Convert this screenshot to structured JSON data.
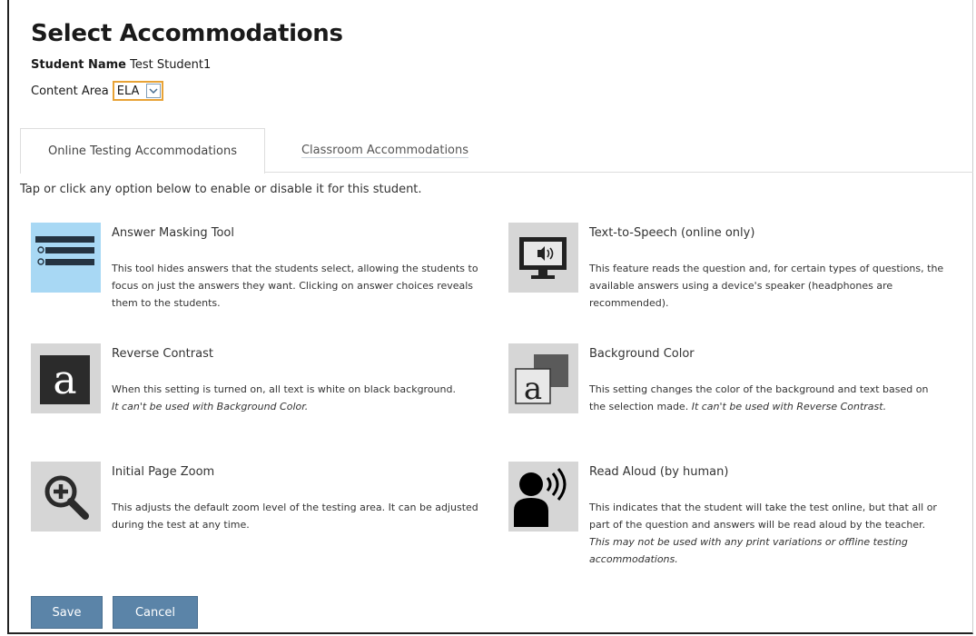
{
  "page": {
    "title": "Select Accommodations",
    "student_label": "Student Name",
    "student_name": "Test Student1",
    "content_area_label": "Content Area",
    "content_area_value": "ELA"
  },
  "tabs": [
    {
      "label": "Online Testing Accommodations",
      "active": true
    },
    {
      "label": "Classroom Accommodations",
      "active": false
    }
  ],
  "instructions": "Tap or click any option below to enable or disable it for this student.",
  "accommodations": [
    {
      "name": "Answer Masking Tool",
      "description": "This tool hides answers that the students select, allowing the students to focus on just the answers they want. Clicking on answer choices reveals them to the students.",
      "note": "",
      "icon": "answer-masking-icon",
      "enabled": true
    },
    {
      "name": "Text-to-Speech (online only)",
      "description": "This feature reads the question and, for certain types of questions, the available answers using a device's speaker (headphones are recommended).",
      "note": "",
      "icon": "monitor-speaker-icon",
      "enabled": false
    },
    {
      "name": "Reverse Contrast",
      "description": "When this setting is turned on, all text is white on black background.",
      "note": "It can't be used with Background Color.",
      "icon": "reverse-contrast-icon",
      "enabled": false
    },
    {
      "name": "Background Color",
      "description": "This setting changes the color of the background and text based on the selection made.",
      "note": "It can't be used with Reverse Contrast.",
      "icon": "background-color-icon",
      "enabled": false
    },
    {
      "name": "Initial Page Zoom",
      "description": "This adjusts the default zoom level of the testing area. It can be adjusted during the test at any time.",
      "note": "",
      "icon": "zoom-in-icon",
      "enabled": false
    },
    {
      "name": "Read Aloud (by human)",
      "description": "This indicates that the student will take the test online, but that all or part of the question and answers will be read aloud by the teacher.",
      "note": "This may not be used with any print variations or offline testing accommodations.",
      "icon": "person-speaking-icon",
      "enabled": false
    }
  ],
  "buttons": {
    "save": "Save",
    "cancel": "Cancel"
  },
  "colors": {
    "enabled_icon_bg": "#a8d8f4",
    "disabled_icon_bg": "#d6d6d6",
    "button_bg": "#5b84a8",
    "select_border": "#e8a336"
  }
}
